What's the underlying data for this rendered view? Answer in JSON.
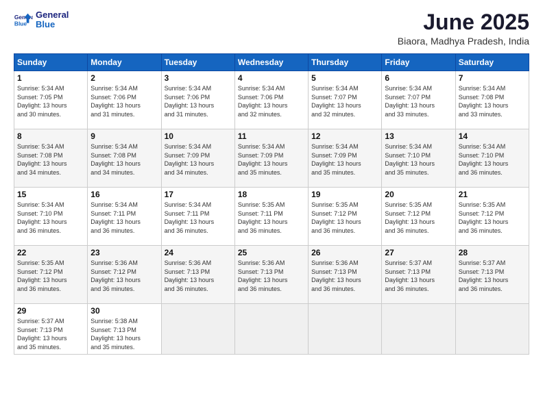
{
  "header": {
    "logo": {
      "line1": "General",
      "line2": "Blue"
    },
    "title": "June 2025",
    "subtitle": "Biaora, Madhya Pradesh, India"
  },
  "weekdays": [
    "Sunday",
    "Monday",
    "Tuesday",
    "Wednesday",
    "Thursday",
    "Friday",
    "Saturday"
  ],
  "weeks": [
    [
      {
        "day": "1",
        "lines": [
          "Sunrise: 5:34 AM",
          "Sunset: 7:05 PM",
          "Daylight: 13 hours",
          "and 30 minutes."
        ]
      },
      {
        "day": "2",
        "lines": [
          "Sunrise: 5:34 AM",
          "Sunset: 7:06 PM",
          "Daylight: 13 hours",
          "and 31 minutes."
        ]
      },
      {
        "day": "3",
        "lines": [
          "Sunrise: 5:34 AM",
          "Sunset: 7:06 PM",
          "Daylight: 13 hours",
          "and 31 minutes."
        ]
      },
      {
        "day": "4",
        "lines": [
          "Sunrise: 5:34 AM",
          "Sunset: 7:06 PM",
          "Daylight: 13 hours",
          "and 32 minutes."
        ]
      },
      {
        "day": "5",
        "lines": [
          "Sunrise: 5:34 AM",
          "Sunset: 7:07 PM",
          "Daylight: 13 hours",
          "and 32 minutes."
        ]
      },
      {
        "day": "6",
        "lines": [
          "Sunrise: 5:34 AM",
          "Sunset: 7:07 PM",
          "Daylight: 13 hours",
          "and 33 minutes."
        ]
      },
      {
        "day": "7",
        "lines": [
          "Sunrise: 5:34 AM",
          "Sunset: 7:08 PM",
          "Daylight: 13 hours",
          "and 33 minutes."
        ]
      }
    ],
    [
      {
        "day": "8",
        "lines": [
          "Sunrise: 5:34 AM",
          "Sunset: 7:08 PM",
          "Daylight: 13 hours",
          "and 34 minutes."
        ]
      },
      {
        "day": "9",
        "lines": [
          "Sunrise: 5:34 AM",
          "Sunset: 7:08 PM",
          "Daylight: 13 hours",
          "and 34 minutes."
        ]
      },
      {
        "day": "10",
        "lines": [
          "Sunrise: 5:34 AM",
          "Sunset: 7:09 PM",
          "Daylight: 13 hours",
          "and 34 minutes."
        ]
      },
      {
        "day": "11",
        "lines": [
          "Sunrise: 5:34 AM",
          "Sunset: 7:09 PM",
          "Daylight: 13 hours",
          "and 35 minutes."
        ]
      },
      {
        "day": "12",
        "lines": [
          "Sunrise: 5:34 AM",
          "Sunset: 7:09 PM",
          "Daylight: 13 hours",
          "and 35 minutes."
        ]
      },
      {
        "day": "13",
        "lines": [
          "Sunrise: 5:34 AM",
          "Sunset: 7:10 PM",
          "Daylight: 13 hours",
          "and 35 minutes."
        ]
      },
      {
        "day": "14",
        "lines": [
          "Sunrise: 5:34 AM",
          "Sunset: 7:10 PM",
          "Daylight: 13 hours",
          "and 36 minutes."
        ]
      }
    ],
    [
      {
        "day": "15",
        "lines": [
          "Sunrise: 5:34 AM",
          "Sunset: 7:10 PM",
          "Daylight: 13 hours",
          "and 36 minutes."
        ]
      },
      {
        "day": "16",
        "lines": [
          "Sunrise: 5:34 AM",
          "Sunset: 7:11 PM",
          "Daylight: 13 hours",
          "and 36 minutes."
        ]
      },
      {
        "day": "17",
        "lines": [
          "Sunrise: 5:34 AM",
          "Sunset: 7:11 PM",
          "Daylight: 13 hours",
          "and 36 minutes."
        ]
      },
      {
        "day": "18",
        "lines": [
          "Sunrise: 5:35 AM",
          "Sunset: 7:11 PM",
          "Daylight: 13 hours",
          "and 36 minutes."
        ]
      },
      {
        "day": "19",
        "lines": [
          "Sunrise: 5:35 AM",
          "Sunset: 7:12 PM",
          "Daylight: 13 hours",
          "and 36 minutes."
        ]
      },
      {
        "day": "20",
        "lines": [
          "Sunrise: 5:35 AM",
          "Sunset: 7:12 PM",
          "Daylight: 13 hours",
          "and 36 minutes."
        ]
      },
      {
        "day": "21",
        "lines": [
          "Sunrise: 5:35 AM",
          "Sunset: 7:12 PM",
          "Daylight: 13 hours",
          "and 36 minutes."
        ]
      }
    ],
    [
      {
        "day": "22",
        "lines": [
          "Sunrise: 5:35 AM",
          "Sunset: 7:12 PM",
          "Daylight: 13 hours",
          "and 36 minutes."
        ]
      },
      {
        "day": "23",
        "lines": [
          "Sunrise: 5:36 AM",
          "Sunset: 7:12 PM",
          "Daylight: 13 hours",
          "and 36 minutes."
        ]
      },
      {
        "day": "24",
        "lines": [
          "Sunrise: 5:36 AM",
          "Sunset: 7:13 PM",
          "Daylight: 13 hours",
          "and 36 minutes."
        ]
      },
      {
        "day": "25",
        "lines": [
          "Sunrise: 5:36 AM",
          "Sunset: 7:13 PM",
          "Daylight: 13 hours",
          "and 36 minutes."
        ]
      },
      {
        "day": "26",
        "lines": [
          "Sunrise: 5:36 AM",
          "Sunset: 7:13 PM",
          "Daylight: 13 hours",
          "and 36 minutes."
        ]
      },
      {
        "day": "27",
        "lines": [
          "Sunrise: 5:37 AM",
          "Sunset: 7:13 PM",
          "Daylight: 13 hours",
          "and 36 minutes."
        ]
      },
      {
        "day": "28",
        "lines": [
          "Sunrise: 5:37 AM",
          "Sunset: 7:13 PM",
          "Daylight: 13 hours",
          "and 36 minutes."
        ]
      }
    ],
    [
      {
        "day": "29",
        "lines": [
          "Sunrise: 5:37 AM",
          "Sunset: 7:13 PM",
          "Daylight: 13 hours",
          "and 35 minutes."
        ]
      },
      {
        "day": "30",
        "lines": [
          "Sunrise: 5:38 AM",
          "Sunset: 7:13 PM",
          "Daylight: 13 hours",
          "and 35 minutes."
        ]
      },
      {
        "day": "",
        "lines": []
      },
      {
        "day": "",
        "lines": []
      },
      {
        "day": "",
        "lines": []
      },
      {
        "day": "",
        "lines": []
      },
      {
        "day": "",
        "lines": []
      }
    ]
  ]
}
